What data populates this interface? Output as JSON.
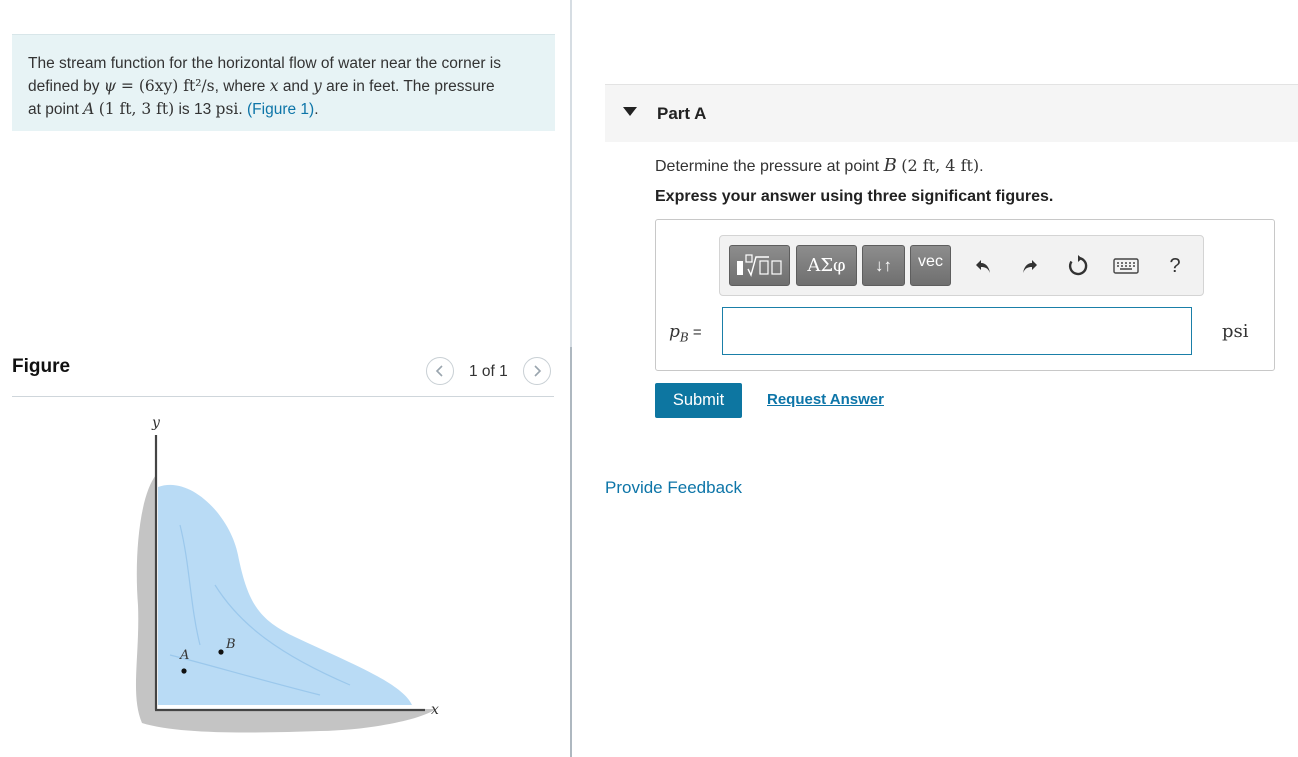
{
  "problem": {
    "line1": "The stream function for the horizontal flow of water near the corner is",
    "line2_prefix": "defined by",
    "psi_symbol": "ψ",
    "equals": " = ",
    "expression": "(6xy) ft²/s",
    "line2_mid": ", where",
    "var_x": "x",
    "and": "and",
    "var_y": "y",
    "line2_suffix": "are in feet. The pressure",
    "line3_prefix": "at point",
    "point_a": "A",
    "point_a_coords": "(1 ft, 3 ft)",
    "line3_mid": "is 13",
    "unit_psi": "psi",
    "line3_link": "(Figure 1)",
    "line3_end": "."
  },
  "figure": {
    "title": "Figure",
    "pager_text": "1 of 1",
    "label_y": "y",
    "label_x": "x",
    "label_a": "A",
    "label_b": "B"
  },
  "part": {
    "title": "Part A",
    "question_prefix": "Determine the pressure at point",
    "point_b": "B",
    "point_b_coords": "(2 ft, 4 ft)",
    "question_end": ".",
    "instruction": "Express your answer using three significant figures."
  },
  "toolbar": {
    "greek_label": "ΑΣφ",
    "arrows_label": "↓↑",
    "vec_label": "vec",
    "help_label": "?"
  },
  "answer": {
    "label_var": "p",
    "label_sub": "B",
    "label_eq": " =",
    "value": "",
    "unit": "psi"
  },
  "actions": {
    "submit_label": "Submit",
    "request_answer_label": "Request Answer",
    "feedback_label": "Provide Feedback"
  },
  "colors": {
    "accent": "#0d76a1",
    "link": "#0d75a8",
    "problem_bg": "#e7f3f5",
    "water": "#b9dbf5"
  }
}
